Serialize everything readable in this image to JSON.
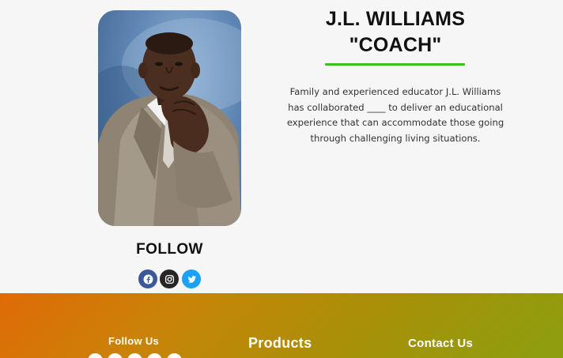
{
  "profile": {
    "name_line1": "J.L. WILLIAMS",
    "name_line2": "\"COACH\"",
    "bio": "Family and experienced educator J.L. Williams has collaborated ____ to deliver an educational experience that can accommodate those going through challenging living situations.",
    "accent_color": "#3fbf1f"
  },
  "follow": {
    "heading": "FOLLOW",
    "icons": [
      "facebook-icon",
      "instagram-icon",
      "twitter-icon"
    ]
  },
  "footer": {
    "follow_us": "Follow Us",
    "products": "Products",
    "contact_us": "Contact Us",
    "gradient": [
      "#e06a07",
      "#8b9f0f"
    ]
  }
}
